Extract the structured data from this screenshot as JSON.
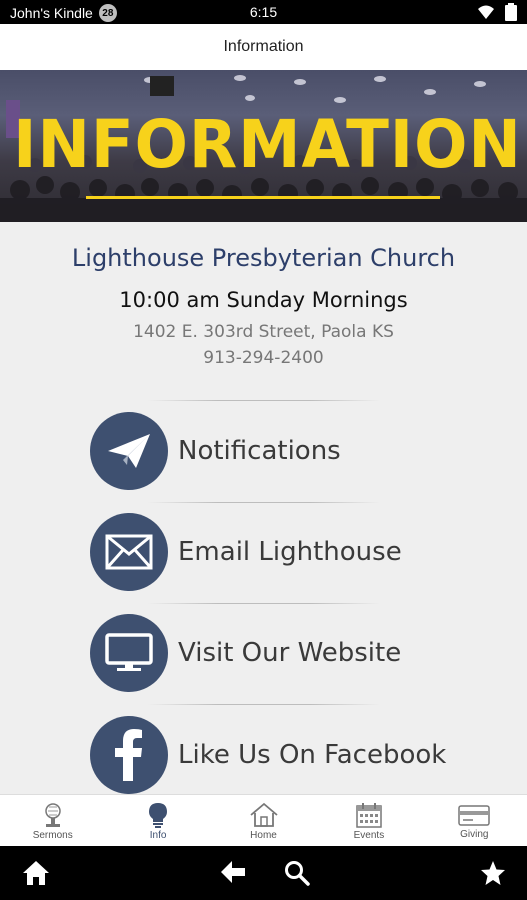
{
  "status_bar": {
    "device_name": "John's Kindle",
    "badge": "28",
    "time": "6:15"
  },
  "title_bar": {
    "title": "Information"
  },
  "banner": {
    "heading": "INFORMATION"
  },
  "church": {
    "name": "Lighthouse Presbyterian Church",
    "service_time": "10:00 am Sunday Mornings",
    "address": "1402 E. 303rd Street, Paola KS",
    "phone": "913-294-2400"
  },
  "actions": [
    {
      "label": "Notifications",
      "icon": "paper-plane-icon"
    },
    {
      "label": "Email Lighthouse",
      "icon": "envelope-icon"
    },
    {
      "label": "Visit Our Website",
      "icon": "monitor-icon"
    },
    {
      "label": "Like Us On Facebook",
      "icon": "facebook-icon"
    }
  ],
  "tabs": [
    {
      "label": "Sermons",
      "icon": "microphone-icon",
      "active": false
    },
    {
      "label": "Info",
      "icon": "lightbulb-icon",
      "active": true
    },
    {
      "label": "Home",
      "icon": "home-icon",
      "active": false
    },
    {
      "label": "Events",
      "icon": "calendar-icon",
      "active": false
    },
    {
      "label": "Giving",
      "icon": "credit-card-icon",
      "active": false
    }
  ],
  "colors": {
    "accent_yellow": "#f7d21b",
    "navy": "#3e5070",
    "church_name": "#2d3f6a"
  }
}
